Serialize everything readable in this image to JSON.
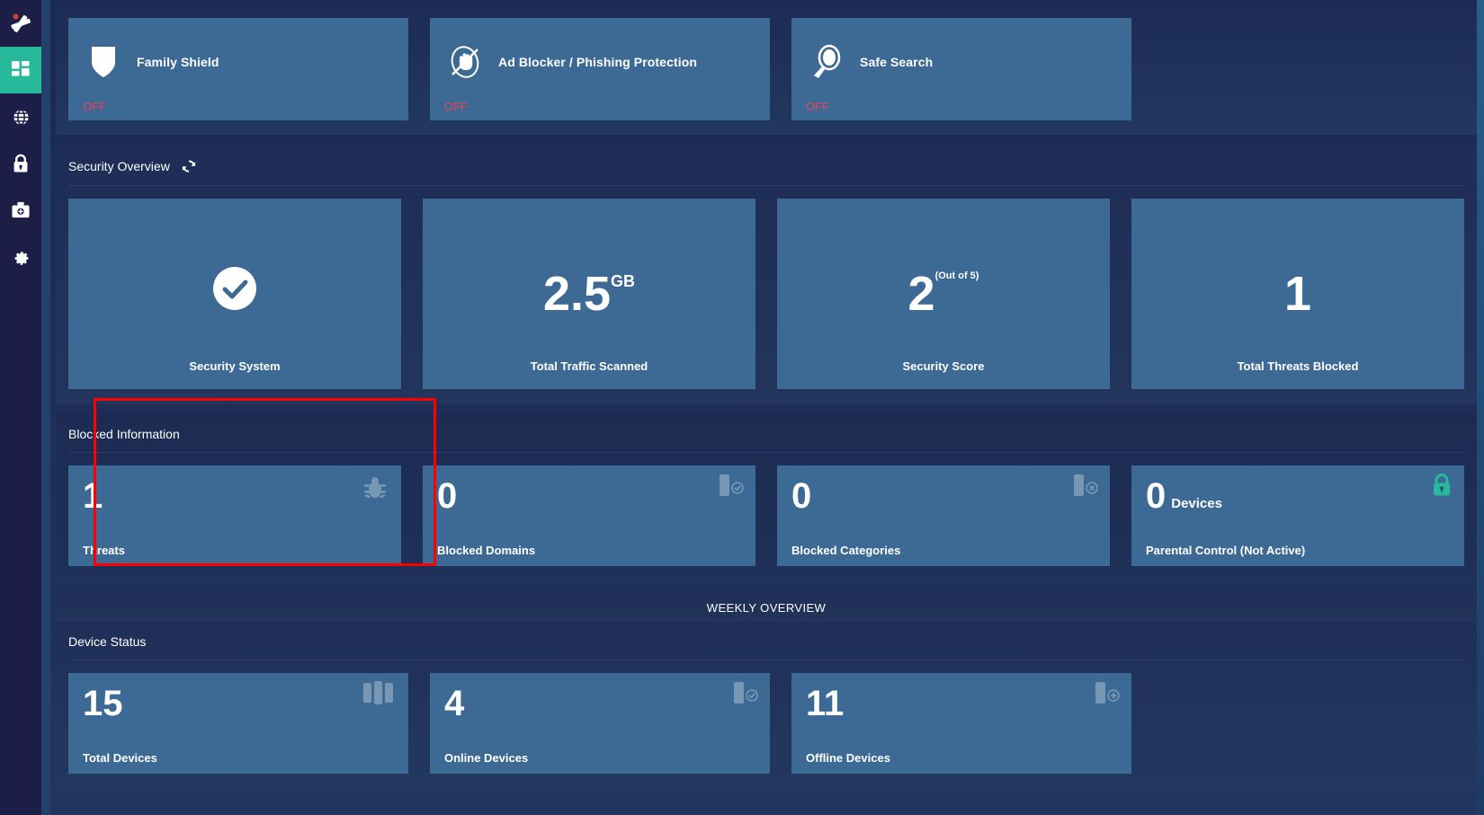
{
  "sidebar": {
    "logo_name": "app-logo",
    "items": [
      {
        "name": "dashboard",
        "icon": "dashboard-icon",
        "active": true
      },
      {
        "name": "network",
        "icon": "globe-icon",
        "active": false
      },
      {
        "name": "security",
        "icon": "lock-icon",
        "active": false
      },
      {
        "name": "diagnostics",
        "icon": "medical-kit-icon",
        "active": false
      },
      {
        "name": "settings",
        "icon": "gear-icon",
        "active": false
      }
    ]
  },
  "features": [
    {
      "title": "Family Shield",
      "state": "OFF",
      "icon": "shield-icon"
    },
    {
      "title": "Ad Blocker / Phishing Protection",
      "state": "OFF",
      "icon": "no-hand-icon"
    },
    {
      "title": "Safe Search",
      "state": "OFF",
      "icon": "magnifier-icon"
    }
  ],
  "security_overview": {
    "title": "Security Overview",
    "refresh_icon": "refresh-icon",
    "cards": [
      {
        "value": "",
        "sup": "",
        "label": "Security System",
        "icon": "check-circle-icon"
      },
      {
        "value": "2.5",
        "sup": "GB",
        "label": "Total Traffic Scanned",
        "icon": ""
      },
      {
        "value": "2",
        "sup": "(Out of 5)",
        "label": "Security Score",
        "icon": ""
      },
      {
        "value": "1",
        "sup": "",
        "label": "Total Threats Blocked",
        "icon": ""
      }
    ]
  },
  "blocked_information": {
    "title": "Blocked Information",
    "cards": [
      {
        "value": "1",
        "unit": "",
        "label": "Threats",
        "icon": "bug-icon",
        "accent": false
      },
      {
        "value": "0",
        "unit": "",
        "label": "Blocked Domains",
        "icon": "device-check-icon",
        "accent": false
      },
      {
        "value": "0",
        "unit": "",
        "label": "Blocked Categories",
        "icon": "device-x-icon",
        "accent": false
      },
      {
        "value": "0",
        "unit": "Devices",
        "label": "Parental Control (Not Active)",
        "icon": "lock-icon",
        "accent": true
      }
    ]
  },
  "weekly_overview": {
    "text": "WEEKLY OVERVIEW"
  },
  "device_status": {
    "title": "Device Status",
    "cards": [
      {
        "value": "15",
        "unit": "",
        "label": "Total Devices",
        "icon": "devices-group-icon"
      },
      {
        "value": "4",
        "unit": "",
        "label": "Online Devices",
        "icon": "device-check-icon"
      },
      {
        "value": "11",
        "unit": "",
        "label": "Offline Devices",
        "icon": "device-plus-icon"
      }
    ]
  },
  "colors": {
    "accent": "#26b99a",
    "card": "#3d6a95",
    "background": "#1b2a52",
    "off_state": "#e8425c",
    "annotation": "#ff0000"
  }
}
